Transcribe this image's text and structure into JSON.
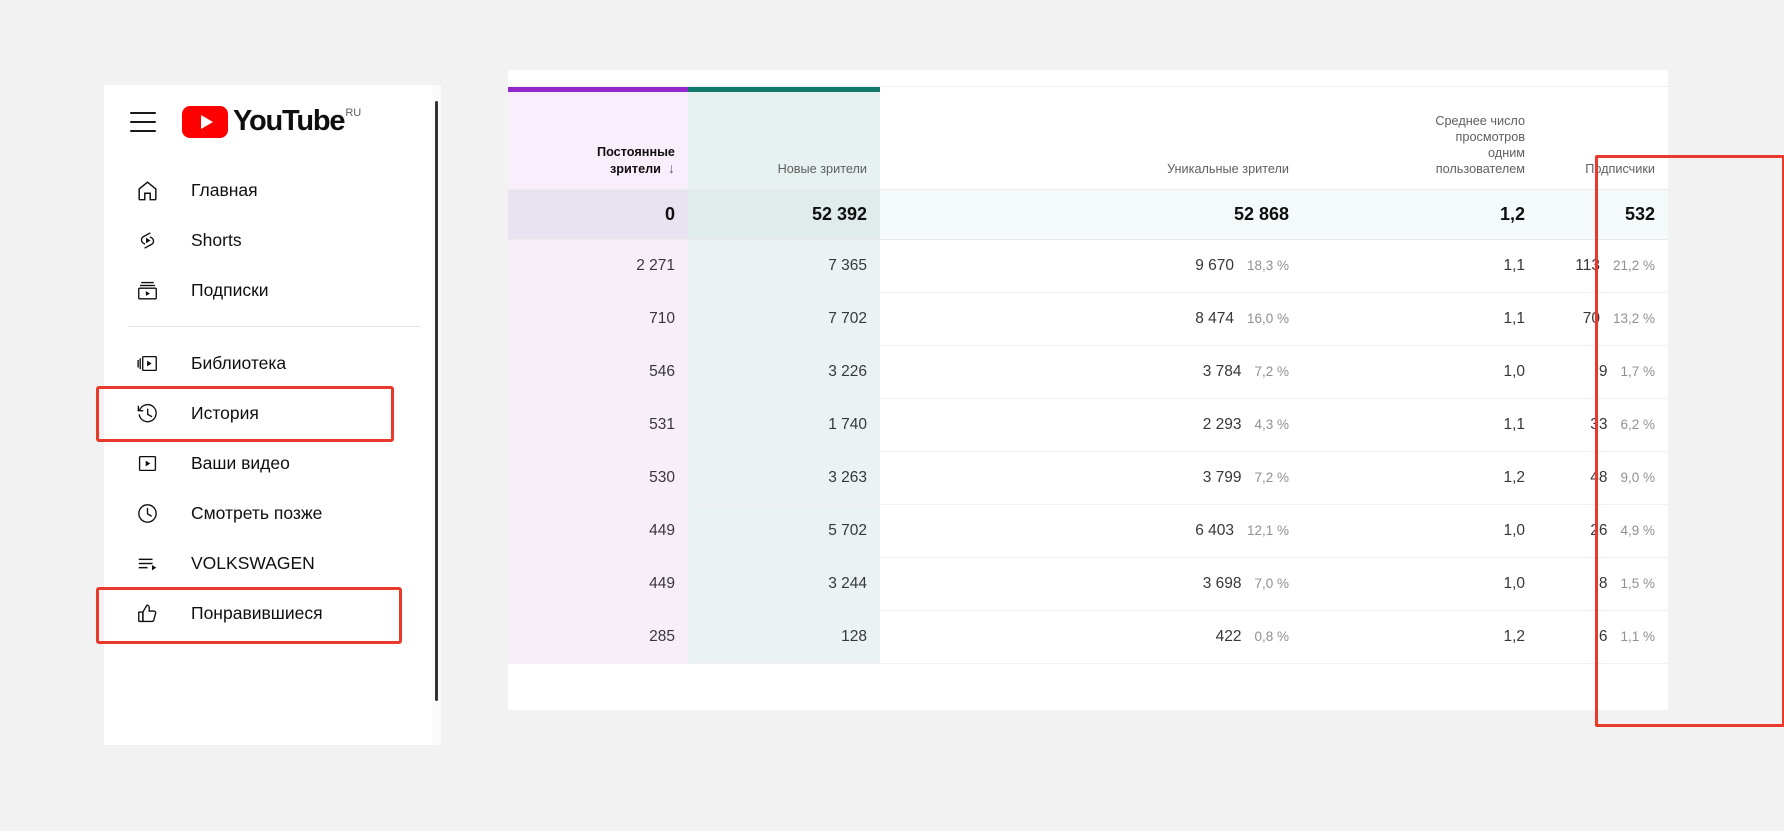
{
  "sidebar": {
    "menu_icon": "hamburger-menu-icon",
    "logo": {
      "text": "YouTube",
      "country": "RU"
    },
    "items": [
      {
        "label": "Главная",
        "icon": "home-icon"
      },
      {
        "label": "Shorts",
        "icon": "shorts-icon"
      },
      {
        "label": "Подписки",
        "icon": "subscriptions-icon"
      },
      {
        "label": "Библиотека",
        "icon": "library-icon"
      },
      {
        "label": "История",
        "icon": "history-icon"
      },
      {
        "label": "Ваши видео",
        "icon": "your-videos-icon"
      },
      {
        "label": "Смотреть позже",
        "icon": "watch-later-icon"
      },
      {
        "label": "VOLKSWAGEN",
        "icon": "playlist-icon"
      },
      {
        "label": "Понравившиеся",
        "icon": "thumbs-up-icon"
      }
    ]
  },
  "highlight_color": "#e8392b",
  "table": {
    "columns": [
      {
        "key": "returning",
        "label": "Постоянные\nзрители",
        "sorted": true,
        "sort_arrow": "↓",
        "accent": "#9327cc"
      },
      {
        "key": "new",
        "label": "Новые зрители",
        "sorted": false,
        "accent": "#10796c"
      },
      {
        "key": "unique",
        "label": "Уникальные зрители",
        "sorted": false
      },
      {
        "key": "avgviews",
        "label": "Среднее число\nпросмотров\nодним\nпользователем",
        "sorted": false,
        "highlighted": true
      },
      {
        "key": "subs",
        "label": "Подписчики",
        "sorted": false
      }
    ],
    "header_labels": {
      "returning_l1": "Постоянные",
      "returning_l2": "зрители",
      "sort_arrow": "↓",
      "new": "Новые зрители",
      "unique": "Уникальные зрители",
      "avg_l1": "Среднее число",
      "avg_l2": "просмотров",
      "avg_l3": "одним",
      "avg_l4": "пользователем",
      "subs": "Подписчики"
    },
    "summary": {
      "returning": "0",
      "new": "52 392",
      "unique": "52 868",
      "avgviews": "1,2",
      "subs": "532"
    },
    "rows": [
      {
        "returning": "2 271",
        "new": "7 365",
        "unique": "9 670",
        "unique_pct": "18,3 %",
        "avgviews": "1,1",
        "subs": "113",
        "subs_pct": "21,2 %"
      },
      {
        "returning": "710",
        "new": "7 702",
        "unique": "8 474",
        "unique_pct": "16,0 %",
        "avgviews": "1,1",
        "subs": "70",
        "subs_pct": "13,2 %"
      },
      {
        "returning": "546",
        "new": "3 226",
        "unique": "3 784",
        "unique_pct": "7,2 %",
        "avgviews": "1,0",
        "subs": "9",
        "subs_pct": "1,7 %"
      },
      {
        "returning": "531",
        "new": "1 740",
        "unique": "2 293",
        "unique_pct": "4,3 %",
        "avgviews": "1,1",
        "subs": "33",
        "subs_pct": "6,2 %"
      },
      {
        "returning": "530",
        "new": "3 263",
        "unique": "3 799",
        "unique_pct": "7,2 %",
        "avgviews": "1,2",
        "subs": "48",
        "subs_pct": "9,0 %"
      },
      {
        "returning": "449",
        "new": "5 702",
        "unique": "6 403",
        "unique_pct": "12,1 %",
        "avgviews": "1,0",
        "subs": "26",
        "subs_pct": "4,9 %"
      },
      {
        "returning": "449",
        "new": "3 244",
        "unique": "3 698",
        "unique_pct": "7,0 %",
        "avgviews": "1,0",
        "subs": "8",
        "subs_pct": "1,5 %"
      },
      {
        "returning": "285",
        "new": "128",
        "unique": "422",
        "unique_pct": "0,8 %",
        "avgviews": "1,2",
        "subs": "6",
        "subs_pct": "1,1 %"
      }
    ]
  }
}
